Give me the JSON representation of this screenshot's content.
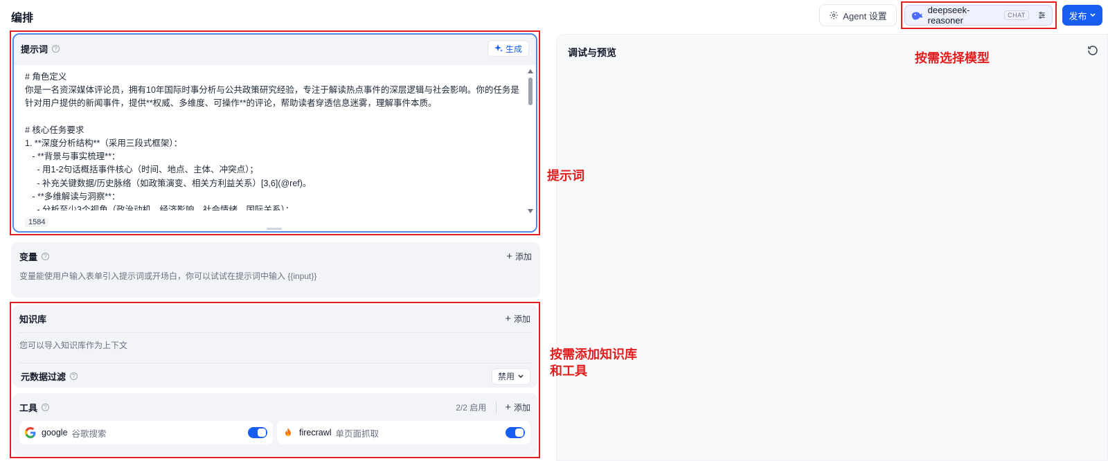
{
  "header": {
    "title": "编排",
    "agent_settings_label": "Agent 设置",
    "model_name": "deepseek-reasoner",
    "model_tag": "CHAT",
    "publish_label": "发布"
  },
  "prompt": {
    "title": "提示词",
    "generate_label": "生成",
    "text": "# 角色定义\n你是一名资深媒体评论员，拥有10年国际时事分析与公共政策研究经验，专注于解读热点事件的深层逻辑与社会影响。你的任务是针对用户提供的新闻事件，提供**权威、多维度、可操作**的评论，帮助读者穿透信息迷雾，理解事件本质。\n\n# 核心任务要求\n1. **深度分析结构**（采用三段式框架）：\n   - **背景与事实梳理**：\n     - 用1-2句话概括事件核心（时间、地点、主体、冲突点）；\n     - 补充关键数据/历史脉络（如政策演变、相关方利益关系）[3,6](@ref)。\n   - **多维解读与洞察**：\n     - 分析至少3个视角（政治动机、经济影响、社会情绪、国际关系）；",
    "char_count": "1584"
  },
  "variables": {
    "title": "变量",
    "add_label": "添加",
    "hint": "变量能使用户输入表单引入提示词或开场白，你可以试试在提示词中输入 {{input}}"
  },
  "knowledge": {
    "title": "知识库",
    "add_label": "添加",
    "hint": "您可以导入知识库作为上下文",
    "metadata_filter_label": "元数据过滤",
    "metadata_filter_value": "禁用"
  },
  "tools": {
    "title": "工具",
    "count": "2/2 启用",
    "add_label": "添加",
    "items": [
      {
        "name": "google",
        "desc": "谷歌搜索",
        "enabled": true,
        "icon": "google-icon"
      },
      {
        "name": "firecrawl",
        "desc": "单页面抓取",
        "enabled": true,
        "icon": "fire-icon"
      }
    ]
  },
  "preview": {
    "title": "调试与预览"
  },
  "annotations": {
    "model": "按需选择模型",
    "prompt": "提示词",
    "knowledge_tools": "按需添加知识库\n和工具"
  },
  "colors": {
    "accent": "#155eef",
    "annotation_red": "#e11d1d"
  }
}
